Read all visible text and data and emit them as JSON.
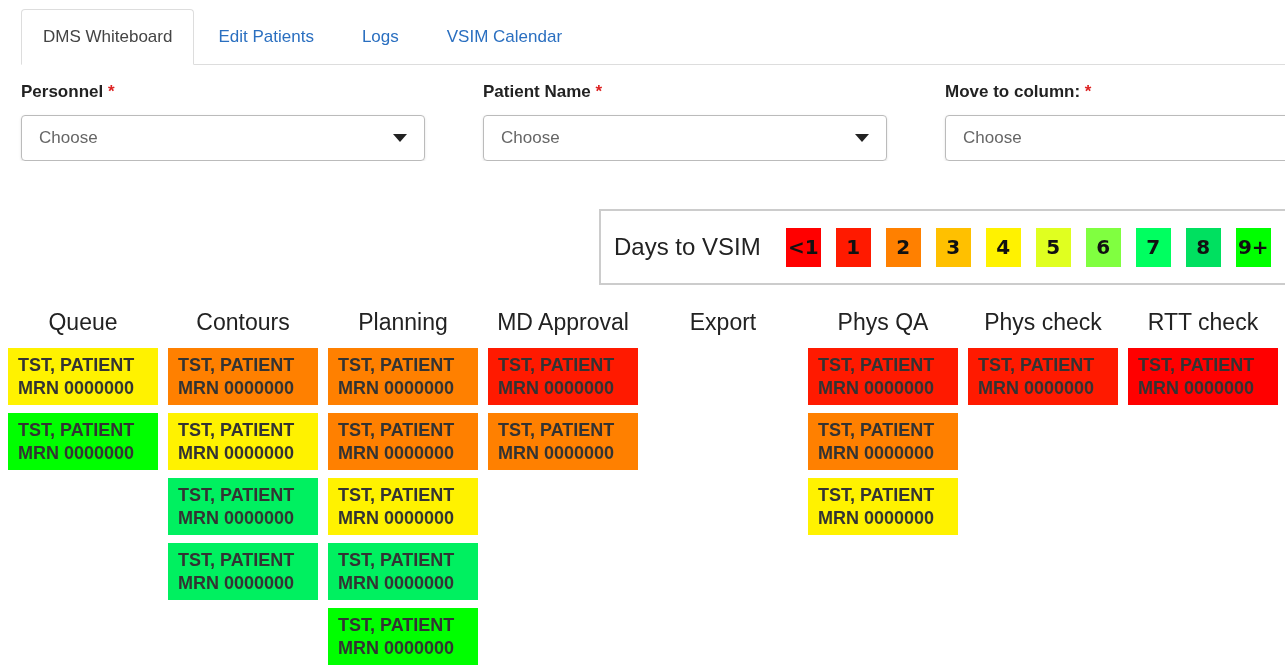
{
  "tabs": [
    {
      "label": "DMS Whiteboard",
      "selected": true
    },
    {
      "label": "Edit Patients",
      "selected": false
    },
    {
      "label": "Logs",
      "selected": false
    },
    {
      "label": "VSIM Calendar",
      "selected": false
    }
  ],
  "fields": [
    {
      "label": "Personnel",
      "required_mark": "*",
      "placeholder": "Choose",
      "caret": true
    },
    {
      "label": "Patient Name",
      "required_mark": "*",
      "placeholder": "Choose",
      "caret": true
    },
    {
      "label": "Move to column:",
      "required_mark": "*",
      "placeholder": "Choose"
    }
  ],
  "legend": {
    "title": "Days to VSIM",
    "items": [
      {
        "label": "<1",
        "color": "#ff0000"
      },
      {
        "label": "1",
        "color": "#ff1a00"
      },
      {
        "label": "2",
        "color": "#ff8000"
      },
      {
        "label": "3",
        "color": "#ffc000"
      },
      {
        "label": "4",
        "color": "#fff200"
      },
      {
        "label": "5",
        "color": "#e0ff20"
      },
      {
        "label": "6",
        "color": "#80ff40"
      },
      {
        "label": "7",
        "color": "#00ff60"
      },
      {
        "label": "8",
        "color": "#00e060"
      },
      {
        "label": "9+",
        "color": "#00ff00"
      }
    ]
  },
  "columns": [
    {
      "title": "Queue",
      "cards": [
        {
          "name": "TST, PATIENT",
          "mrn": "MRN 0000000",
          "color": "#fff200"
        },
        {
          "name": "TST, PATIENT",
          "mrn": "MRN 0000000",
          "color": "#00ff00"
        }
      ]
    },
    {
      "title": "Contours",
      "cards": [
        {
          "name": "TST, PATIENT",
          "mrn": "MRN 0000000",
          "color": "#ff8000"
        },
        {
          "name": "TST, PATIENT",
          "mrn": "MRN 0000000",
          "color": "#fff200"
        },
        {
          "name": "TST, PATIENT",
          "mrn": "MRN 0000000",
          "color": "#00f060"
        },
        {
          "name": "TST, PATIENT",
          "mrn": "MRN 0000000",
          "color": "#00f060"
        }
      ]
    },
    {
      "title": "Planning",
      "cards": [
        {
          "name": "TST, PATIENT",
          "mrn": "MRN 0000000",
          "color": "#ff8000"
        },
        {
          "name": "TST, PATIENT",
          "mrn": "MRN 0000000",
          "color": "#ff8000"
        },
        {
          "name": "TST, PATIENT",
          "mrn": "MRN 0000000",
          "color": "#fff200"
        },
        {
          "name": "TST, PATIENT",
          "mrn": "MRN 0000000",
          "color": "#00f060"
        },
        {
          "name": "TST, PATIENT",
          "mrn": "MRN 0000000",
          "color": "#00ff00"
        }
      ]
    },
    {
      "title": "MD Approval",
      "cards": [
        {
          "name": "TST, PATIENT",
          "mrn": "MRN 0000000",
          "color": "#ff1a00"
        },
        {
          "name": "TST, PATIENT",
          "mrn": "MRN 0000000",
          "color": "#ff8000"
        }
      ]
    },
    {
      "title": "Export"
    },
    {
      "title": "Phys QA",
      "cards": [
        {
          "name": "TST, PATIENT",
          "mrn": "MRN 0000000",
          "color": "#ff1a00"
        },
        {
          "name": "TST, PATIENT",
          "mrn": "MRN 0000000",
          "color": "#ff8000"
        },
        {
          "name": "TST, PATIENT",
          "mrn": "MRN 0000000",
          "color": "#fff200"
        }
      ]
    },
    {
      "title": "Phys check",
      "cards": [
        {
          "name": "TST, PATIENT",
          "mrn": "MRN 0000000",
          "color": "#ff1a00"
        }
      ]
    },
    {
      "title": "RTT check",
      "cards": [
        {
          "name": "TST, PATIENT",
          "mrn": "MRN 0000000",
          "color": "#ff0000"
        }
      ]
    }
  ]
}
